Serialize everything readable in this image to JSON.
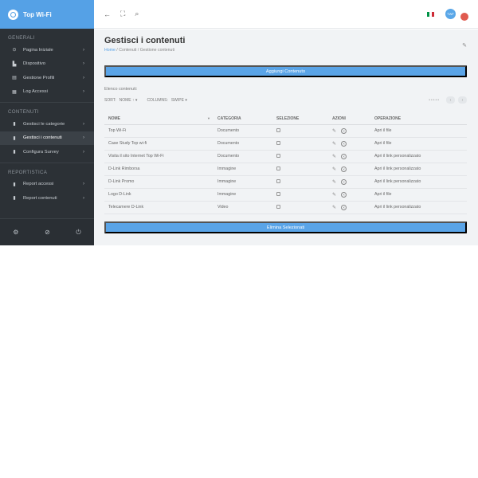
{
  "app": {
    "title": "Top Wi-Fi"
  },
  "sidebar": {
    "sections": [
      {
        "title": "GENERALI",
        "items": [
          {
            "label": "Pagina Iniziale",
            "icon": "home-icon"
          },
          {
            "label": "Dispositivo",
            "icon": "device-icon"
          },
          {
            "label": "Gestione Profili",
            "icon": "profile-icon"
          },
          {
            "label": "Log Accessi",
            "icon": "log-icon"
          }
        ]
      },
      {
        "title": "CONTENUTI",
        "items": [
          {
            "label": "Gestisci le categorie",
            "icon": "bookmark-icon"
          },
          {
            "label": "Gestisci i contenuti",
            "icon": "bookmark-icon",
            "active": true
          },
          {
            "label": "Configura Survey",
            "icon": "bookmark-icon"
          }
        ]
      },
      {
        "title": "REPORTISTICA",
        "items": [
          {
            "label": "Report accessi",
            "icon": "bookmark-icon"
          },
          {
            "label": "Report contenuti",
            "icon": "bookmark-icon"
          }
        ]
      }
    ],
    "chevron": "›"
  },
  "topbar": {
    "avatar_text": "TWF",
    "flag_colors": [
      "#009246",
      "#ffffff",
      "#ce2b37"
    ]
  },
  "page": {
    "title": "Gestisci i contenuti",
    "breadcrumb": {
      "home": "Home",
      "sep": "/",
      "parts": [
        "Contenuti",
        "Gestione contenuti"
      ]
    },
    "add_button": "Aggiungi Contenuto",
    "delete_button": "Elimina Selezionati",
    "list_label": "Elenco contenuti:",
    "sort_label": "SORT:",
    "sort_value": "NOME ↑",
    "columns_label": "COLUMNS:",
    "columns_value": "SWIPE"
  },
  "table": {
    "headers": [
      "NOME",
      "CATEGORIA",
      "SELEZIONE",
      "AZIONI",
      "OPERAZIONE"
    ],
    "rows": [
      {
        "nome": "Top Wi-Fi",
        "categoria": "Documento",
        "operazione": "Apri il file"
      },
      {
        "nome": "Case Study Top wi-fi",
        "categoria": "Documento",
        "operazione": "Apri il file"
      },
      {
        "nome": "Visita il sito Internet Top Wi-Fi",
        "categoria": "Documento",
        "operazione": "Apri il link personalizzato"
      },
      {
        "nome": "D-Link Rimborsa",
        "categoria": "Immagine",
        "operazione": "Apri il link personalizzato"
      },
      {
        "nome": "D-Link Promo",
        "categoria": "Immagine",
        "operazione": "Apri il link personalizzato"
      },
      {
        "nome": "Logo D-Link",
        "categoria": "Immagine",
        "operazione": "Apri il file"
      },
      {
        "nome": "Telecamere D-Link",
        "categoria": "Video",
        "operazione": "Apri il link personalizzato"
      }
    ]
  }
}
